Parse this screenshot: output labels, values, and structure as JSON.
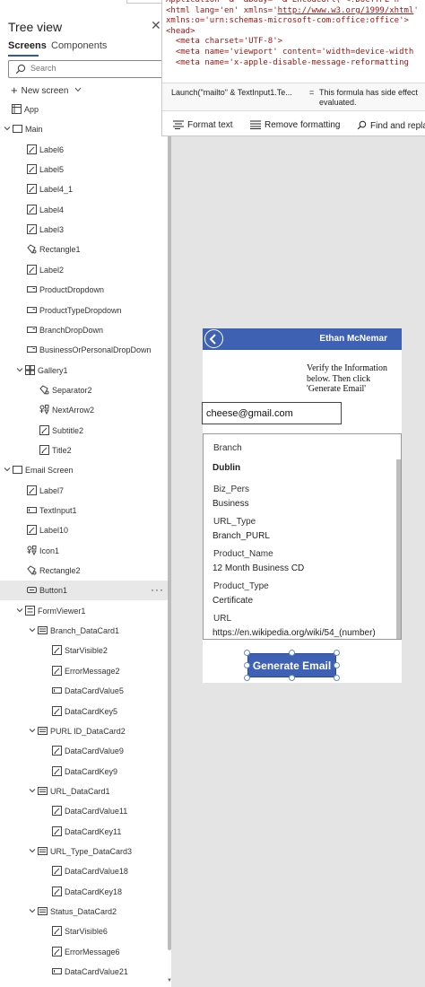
{
  "tree_view": {
    "title": "Tree view",
    "close_glyph": "✕",
    "tabs": [
      {
        "label": "Screens",
        "active": true
      },
      {
        "label": "Components",
        "active": false
      }
    ],
    "search_placeholder": "Search",
    "new_screen_label": "New screen",
    "items": [
      {
        "label": "App",
        "icon": "app-icon"
      },
      {
        "label": "Main",
        "icon": "screen-icon",
        "expanded": true
      },
      {
        "label": "Label6",
        "icon": "label-icon"
      },
      {
        "label": "Label5",
        "icon": "label-icon"
      },
      {
        "label": "Label4_1",
        "icon": "label-icon"
      },
      {
        "label": "Label4",
        "icon": "label-icon"
      },
      {
        "label": "Label3",
        "icon": "label-icon"
      },
      {
        "label": "Rectangle1",
        "icon": "rectangle-icon"
      },
      {
        "label": "Label2",
        "icon": "label-icon"
      },
      {
        "label": "ProductDropdown",
        "icon": "dropdown-icon"
      },
      {
        "label": "ProductTypeDropdown",
        "icon": "dropdown-icon"
      },
      {
        "label": "BranchDropDown",
        "icon": "dropdown-icon"
      },
      {
        "label": "BusinessOrPersonalDropDown",
        "icon": "dropdown-icon"
      },
      {
        "label": "Gallery1",
        "icon": "gallery-icon",
        "expanded": true
      },
      {
        "label": "Separator2",
        "icon": "rectangle-icon"
      },
      {
        "label": "NextArrow2",
        "icon": "icon-control-icon"
      },
      {
        "label": "Subtitle2",
        "icon": "label-icon"
      },
      {
        "label": "Title2",
        "icon": "label-icon"
      },
      {
        "label": "Email Screen",
        "icon": "screen-icon",
        "expanded": true
      },
      {
        "label": "Label7",
        "icon": "label-icon"
      },
      {
        "label": "TextInput1",
        "icon": "textinput-icon"
      },
      {
        "label": "Label10",
        "icon": "label-icon"
      },
      {
        "label": "Icon1",
        "icon": "icon-control-icon"
      },
      {
        "label": "Rectangle2",
        "icon": "rectangle-icon"
      },
      {
        "label": "Button1",
        "icon": "button-icon",
        "selected": true
      },
      {
        "label": "FormViewer1",
        "icon": "form-icon",
        "expanded": true
      },
      {
        "label": "Branch_DataCard1",
        "icon": "datacard-icon",
        "expanded": true
      },
      {
        "label": "StarVisible2",
        "icon": "label-icon"
      },
      {
        "label": "ErrorMessage2",
        "icon": "label-icon"
      },
      {
        "label": "DataCardValue5",
        "icon": "textinput-icon"
      },
      {
        "label": "DataCardKey5",
        "icon": "label-icon"
      },
      {
        "label": "PURL ID_DataCard2",
        "icon": "datacard-icon",
        "expanded": true
      },
      {
        "label": "DataCardValue9",
        "icon": "label-icon"
      },
      {
        "label": "DataCardKey9",
        "icon": "label-icon"
      },
      {
        "label": "URL_DataCard1",
        "icon": "datacard-icon",
        "expanded": true
      },
      {
        "label": "DataCardValue11",
        "icon": "label-icon"
      },
      {
        "label": "DataCardKey11",
        "icon": "label-icon"
      },
      {
        "label": "URL_Type_DataCard3",
        "icon": "datacard-icon",
        "expanded": true
      },
      {
        "label": "DataCardValue18",
        "icon": "label-icon"
      },
      {
        "label": "DataCardKey18",
        "icon": "label-icon"
      },
      {
        "label": "Status_DataCard2",
        "icon": "datacard-icon",
        "expanded": true
      },
      {
        "label": "StarVisible6",
        "icon": "label-icon"
      },
      {
        "label": "ErrorMessage6",
        "icon": "label-icon"
      },
      {
        "label": "DataCardValue21",
        "icon": "textinput-icon"
      }
    ]
  },
  "formula_popup": {
    "code_lines": [
      {
        "pre": "Application\" & \"&body=\" & EncodeUrl(\"<!DOCTYPE h",
        "link": "",
        "post": ""
      },
      {
        "pre": "<html lang='en' xmlns='",
        "link": "http://www.w3.org/1999/xhtml",
        "post": "'"
      },
      {
        "pre": "xmlns:o='urn:schemas-microsoft-com:office:office'>",
        "link": "",
        "post": ""
      },
      {
        "pre": "<head>",
        "link": "",
        "post": ""
      },
      {
        "pre": "  <meta charset='UTF-8'>",
        "link": "",
        "post": ""
      },
      {
        "pre": "  <meta name='viewport' content='width=device-width",
        "link": "",
        "post": ""
      },
      {
        "pre": "  <meta name='x-apple-disable-message-reformatting",
        "link": "",
        "post": ""
      }
    ],
    "expression": "Launch(\"mailto\" & TextInput1.Te...",
    "equals": "=",
    "warning": "This formula has side effect\nevaluated.",
    "toolbar": {
      "format_text": "Format text",
      "remove_formatting": "Remove formatting",
      "find_replace": "Find and repla"
    }
  },
  "app_screen": {
    "header_name": "Ethan McNemar",
    "verify_text": "Verify the Information below. Then click 'Generate Email'",
    "email_value": "cheese@gmail.com",
    "form_fields": [
      {
        "key": "Branch",
        "value": "Dublin"
      },
      {
        "key": "Biz_Pers",
        "value": "Business"
      },
      {
        "key": "URL_Type",
        "value": "Branch_PURL"
      },
      {
        "key": "Product_Name",
        "value": "12 Month Business CD"
      },
      {
        "key": "Product_Type",
        "value": "Certificate"
      },
      {
        "key": "URL",
        "value": "https://en.wikipedia.org/wiki/54_(number)"
      }
    ],
    "generate_button": "Generate Email"
  },
  "colors": {
    "app_header": "#3e61b4",
    "code_text": "#a31515",
    "tab_underline": "#3058a8"
  }
}
